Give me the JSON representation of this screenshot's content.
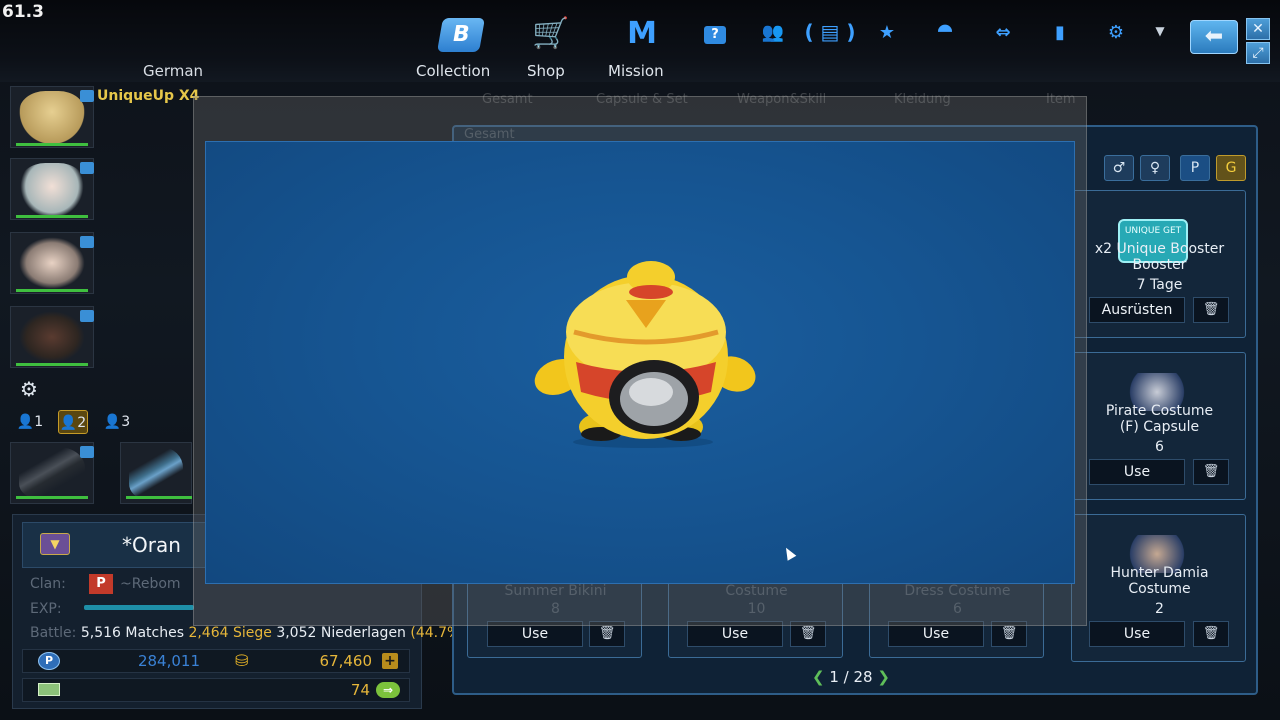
{
  "fps": "61.3",
  "language": "German",
  "nav": {
    "collection_label": "Collection",
    "shop_label": "Shop",
    "mission_label": "Mission",
    "collection_icon": "B",
    "mission_icon": "M"
  },
  "character": {
    "unique_label": "UniqueUp X4",
    "presets": [
      "1",
      "2",
      "3"
    ],
    "active_preset": "2"
  },
  "player": {
    "name": "*Oran",
    "clan_label": "Clan:",
    "clan_name": "~Rebom",
    "exp_label": "EXP:",
    "battle_label": "Battle:",
    "matches": "5,516 Matches",
    "wins": "2,464 Siege",
    "losses": "3,052 Niederlagen",
    "ratio": "(44.7%)",
    "points": "284,011",
    "gold": "67,460",
    "tickets": "74"
  },
  "modal": {
    "tabs": [
      "Gesamt",
      "Capsule & Set",
      "Weapon&Skill",
      "Kleidung",
      "Item"
    ],
    "subtitle": "Gesamt"
  },
  "inventory": {
    "filters": [
      "♂",
      "♀",
      "P",
      "G"
    ],
    "items": [
      {
        "title": "x2 Unique Booster",
        "line2": "Booster",
        "qty": "7 Tage",
        "action": "Ausrüsten",
        "thumb_text": "UNIQUE GET"
      },
      {
        "title": "Pirate Costume",
        "line2": "(F) Capsule",
        "qty": "6",
        "action": "Use"
      },
      {
        "title": "Hunter Damia",
        "line2": "Costume",
        "qty": "2",
        "action": "Use"
      }
    ],
    "bottom_row": [
      {
        "title": "Summer Bikini",
        "qty": "8",
        "action": "Use"
      },
      {
        "title": "Costume",
        "qty": "10",
        "action": "Use"
      },
      {
        "title": "Dress Costume",
        "qty": "6",
        "action": "Use"
      }
    ],
    "pager": "1 / 28"
  }
}
